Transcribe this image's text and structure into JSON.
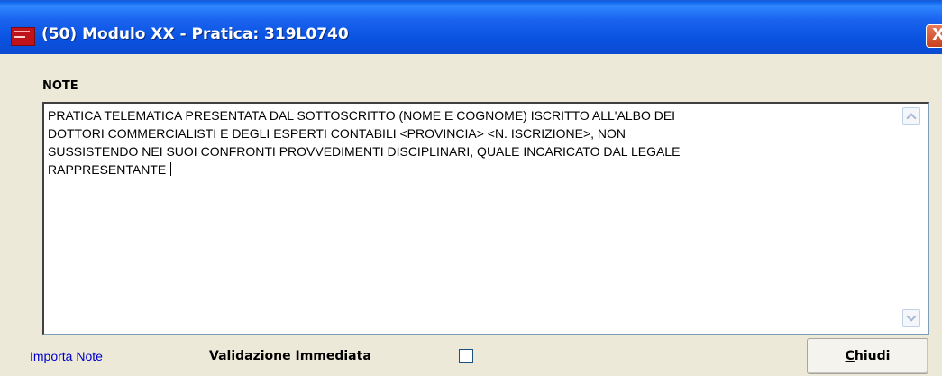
{
  "window": {
    "title": "(50) Modulo XX - Pratica: 319L0740",
    "close_glyph": "X",
    "icon": "app-logo-icon"
  },
  "notes": {
    "label": "NOTE",
    "text": "PRATICA TELEMATICA PRESENTATA DAL SOTTOSCRITTO (NOME E COGNOME) ISCRITTO ALL'ALBO DEI\nDOTTORI COMMERCIALISTI E DEGLI ESPERTI CONTABILI <PROVINCIA> <N. ISCRIZIONE>, NON\nSUSSISTENDO NEI SUOI CONFRONTI PROVVEDIMENTI DISCIPLINARI, QUALE INCARICATO DAL LEGALE\nRAPPRESENTANTE "
  },
  "footer": {
    "import_link": "Importa Note",
    "validation_label": "Validazione Immediata",
    "validation_checked": false,
    "close_button_first": "C",
    "close_button_rest": "hiudi"
  }
}
